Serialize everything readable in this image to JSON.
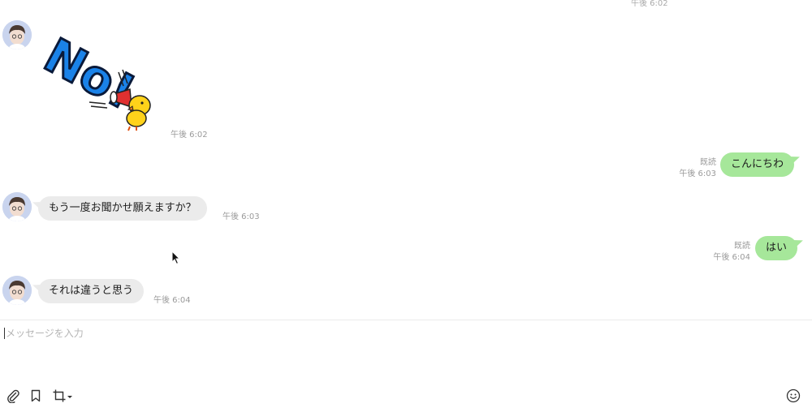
{
  "header": {
    "top_timestamp": "午後 6:02"
  },
  "messages": [
    {
      "type": "sticker",
      "sender": "them",
      "sticker_text": "No!",
      "time": "午後 6:02"
    },
    {
      "type": "text",
      "sender": "me",
      "text": "こんにちわ",
      "read": "既読",
      "time": "午後 6:03"
    },
    {
      "type": "text",
      "sender": "them",
      "text": "もう一度お聞かせ願えますか？",
      "time": "午後 6:03"
    },
    {
      "type": "text",
      "sender": "me",
      "text": "はい",
      "read": "既読",
      "time": "午後 6:04"
    },
    {
      "type": "text",
      "sender": "them",
      "text": "それは違うと思う",
      "time": "午後 6:04"
    }
  ],
  "composer": {
    "placeholder": "メッセージを入力"
  },
  "toolbar": {
    "icons": [
      "paperclip-icon",
      "bookmark-icon",
      "crop-icon",
      "emoji-icon"
    ]
  },
  "colors": {
    "outgoing_bubble": "#a6e79a",
    "incoming_bubble": "#ebebeb"
  }
}
